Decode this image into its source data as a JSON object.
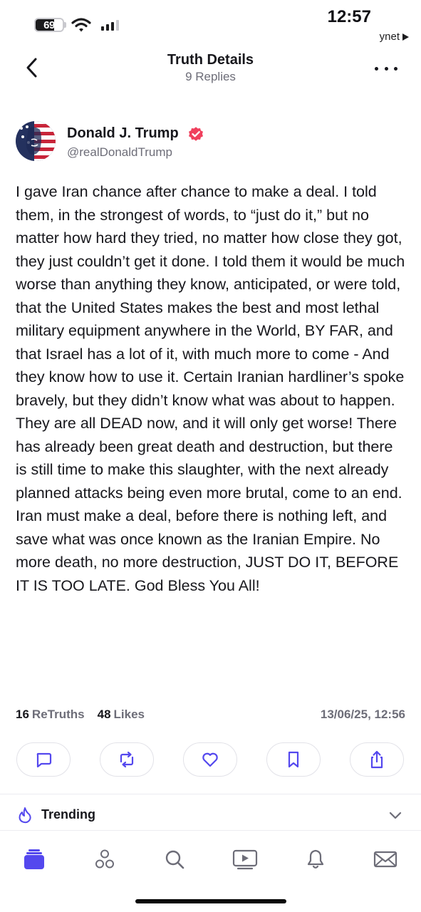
{
  "status_bar": {
    "battery": "69",
    "battery_level_percent": 69,
    "time": "12:57",
    "back_to_app": "ynet"
  },
  "header": {
    "title": "Truth Details",
    "subtitle": "9 Replies",
    "back_icon": "chevron-left-icon",
    "more_icon": "ellipsis-icon"
  },
  "author": {
    "name": "Donald J. Trump",
    "handle": "@realDonaldTrump",
    "verified_icon": "verified-badge-icon",
    "badge_color": "#f0405d"
  },
  "post": {
    "text": "I gave Iran chance after chance to make a deal. I told them, in the strongest of words, to “just do it,” but no matter how hard they tried, no matter how close they got, they just couldn’t get it done. I told them it would be much worse than anything they know, anticipated, or were told, that the United States makes the best and most lethal military equipment anywhere in the World, BY FAR, and that Israel has a lot of it, with much more to come - And they know how to use it. Certain Iranian hardliner’s spoke bravely, but they didn’t know what was about to happen. They are all DEAD now, and it will only get worse! There has already been great death and destruction, but there is still time to make this slaughter, with the next already planned attacks being even more brutal, come to an end. Iran must make a deal, before there is nothing left, and save what was once known as the Iranian Empire. No more death, no more destruction, JUST DO IT, BEFORE IT IS TOO LATE. God Bless You All!"
  },
  "stats": {
    "retruths_count": "16",
    "retruths_label": "ReTruths",
    "likes_count": "48",
    "likes_label": "Likes",
    "timestamp": "13/06/25, 12:56"
  },
  "actions": [
    {
      "name": "reply",
      "icon": "comment-icon"
    },
    {
      "name": "retruth",
      "icon": "repost-icon"
    },
    {
      "name": "like",
      "icon": "heart-icon"
    },
    {
      "name": "bookmark",
      "icon": "bookmark-icon"
    },
    {
      "name": "share",
      "icon": "share-icon"
    }
  ],
  "trending": {
    "label": "Trending",
    "icon": "flame-icon",
    "chevron_icon": "chevron-down-icon"
  },
  "tab_bar": [
    {
      "name": "home",
      "icon": "home-stack-icon",
      "active": true
    },
    {
      "name": "groups",
      "icon": "groups-icon",
      "active": false
    },
    {
      "name": "search",
      "icon": "search-icon",
      "active": false
    },
    {
      "name": "video",
      "icon": "video-icon",
      "active": false
    },
    {
      "name": "notifications",
      "icon": "bell-icon",
      "active": false
    },
    {
      "name": "messages",
      "icon": "mail-icon",
      "active": false
    }
  ],
  "colors": {
    "accent": "#5448ee",
    "text_primary": "#17171c",
    "text_secondary": "#6d6d78",
    "border": "#e2e2e8"
  }
}
